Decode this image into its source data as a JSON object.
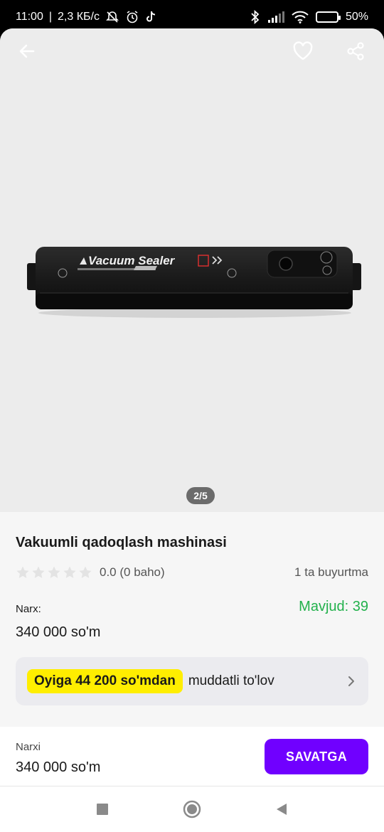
{
  "status_bar": {
    "time": "11:00",
    "network_speed": "2,3 КБ/с",
    "battery_percent": "50%",
    "battery_level": 0.5,
    "icons": [
      "mute-icon",
      "alarm-icon",
      "tiktok-icon",
      "bluetooth-icon",
      "signal-icon",
      "wifi-icon",
      "battery-icon"
    ]
  },
  "gallery": {
    "page_indicator": "2/5",
    "product_image_text": "Vacuum Sealer",
    "actions": [
      "back-arrow-icon",
      "heart-icon",
      "share-icon"
    ]
  },
  "product": {
    "title": "Vakuumli qadoqlash mashinasi",
    "rating": "0.0 (0 baho)",
    "stars_filled": 0,
    "stars_total": 5,
    "orders": "1 ta buyurtma",
    "price_label": "Narx:",
    "price": "340 000 so'm",
    "stock": "Mavjud: 39"
  },
  "installment": {
    "badge": "Oyiga 44 200 so'mdan",
    "text": "muddatli to'lov"
  },
  "cart_bar": {
    "price_label": "Narxi",
    "price": "340 000 so'm",
    "button_label": "SAVATGA"
  },
  "colors": {
    "accent": "#7000ff",
    "stock_green": "#22b14c",
    "badge_yellow": "#ffee00"
  }
}
